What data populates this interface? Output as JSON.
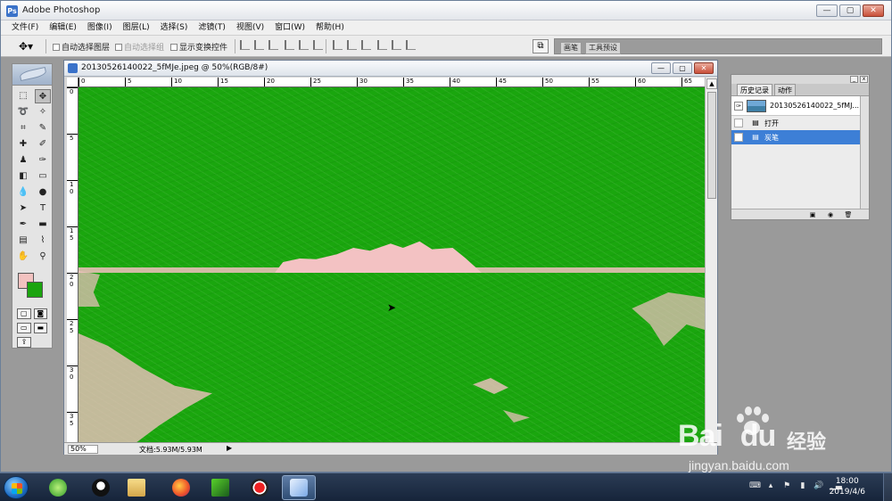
{
  "app": {
    "title": "Adobe Photoshop",
    "icon": "photoshop-icon"
  },
  "menu": [
    "文件(F)",
    "编辑(E)",
    "图像(I)",
    "图层(L)",
    "选择(S)",
    "滤镜(T)",
    "视图(V)",
    "窗口(W)",
    "帮助(H)"
  ],
  "options": {
    "auto_select_layer": "自动选择图层",
    "auto_select_group": "自动选择组",
    "show_transform": "显示变换控件",
    "well_tab_brushes": "画笔",
    "well_tab_presets": "工具预设"
  },
  "document": {
    "title": "20130526140022_5fMJe.jpeg @ 50%(RGB/8#)",
    "zoom": "50%",
    "doc_size": "文档:5.93M/5.93M",
    "ruler_top": [
      "0",
      "5",
      "10",
      "15",
      "20",
      "25",
      "30",
      "35",
      "40",
      "45",
      "50",
      "55",
      "60",
      "65"
    ],
    "ruler_left": [
      "0",
      "5",
      "1 0",
      "1 5",
      "2 0",
      "2 5",
      "3 0",
      "3 5"
    ],
    "canvas_colors": {
      "green": "#1aa60e",
      "pink": "#f3c2c3"
    }
  },
  "toolbox": {
    "foreground_color": "#f3c2c0",
    "background_color": "#1ba40f"
  },
  "history": {
    "tabs": [
      "历史记录",
      "动作"
    ],
    "snapshot_label": "20130526140022_5fMJ...",
    "steps": [
      {
        "label": "打开",
        "selected": false
      },
      {
        "label": "炭笔",
        "selected": true
      }
    ]
  },
  "taskbar": {
    "time": "18:00",
    "date": "2019/4/6",
    "apps": [
      "360-browser-icon",
      "qq-icon",
      "file-explorer-icon",
      "firefox-icon",
      "video-player-icon",
      "record-icon",
      "photoshop-icon"
    ]
  },
  "watermark": {
    "brand": "Bai",
    "brand_suffix": "du",
    "brand_cn": "经验",
    "url": "jingyan.baidu.com"
  }
}
